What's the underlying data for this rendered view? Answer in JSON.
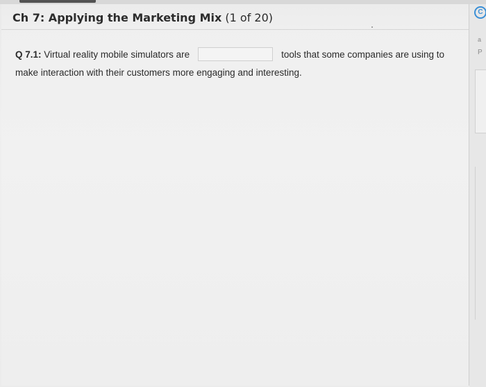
{
  "header": {
    "chapter": "Ch 7: Applying the Marketing Mix",
    "progress": "(1 of 20)"
  },
  "question": {
    "number": "Q 7.1:",
    "text_before": "Virtual reality mobile simulators are",
    "answer_value": "",
    "text_after_line1": "tools that some companies are using to",
    "text_line2": "make interaction with their customers more engaging and interesting."
  },
  "side": {
    "icon": "refresh-circle-icon",
    "glyph_top": "a",
    "glyph_p": "P"
  },
  "colors": {
    "accent": "#3a8fd6",
    "text": "#2a2a2a"
  }
}
